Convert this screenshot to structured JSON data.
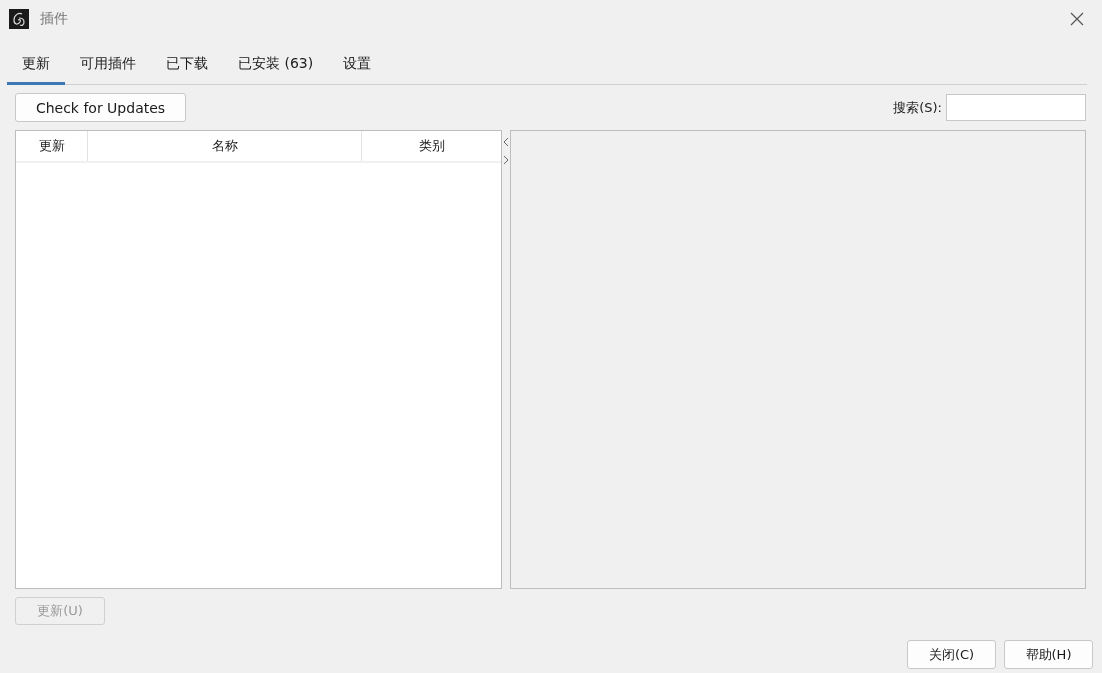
{
  "window": {
    "title": "插件"
  },
  "tabs": [
    {
      "label": "更新",
      "selected": true
    },
    {
      "label": "可用插件",
      "selected": false
    },
    {
      "label": "已下载",
      "selected": false
    },
    {
      "label": "已安装 (63)",
      "selected": false
    },
    {
      "label": "设置",
      "selected": false
    }
  ],
  "check_button": {
    "label": "Check for Updates"
  },
  "search": {
    "label": "搜索(S):"
  },
  "table": {
    "columns": [
      "更新",
      "名称",
      "类别"
    ]
  },
  "update_button": {
    "label": "更新(U)",
    "disabled": true
  },
  "buttons": [
    "关闭(C)",
    "帮助(H)"
  ]
}
